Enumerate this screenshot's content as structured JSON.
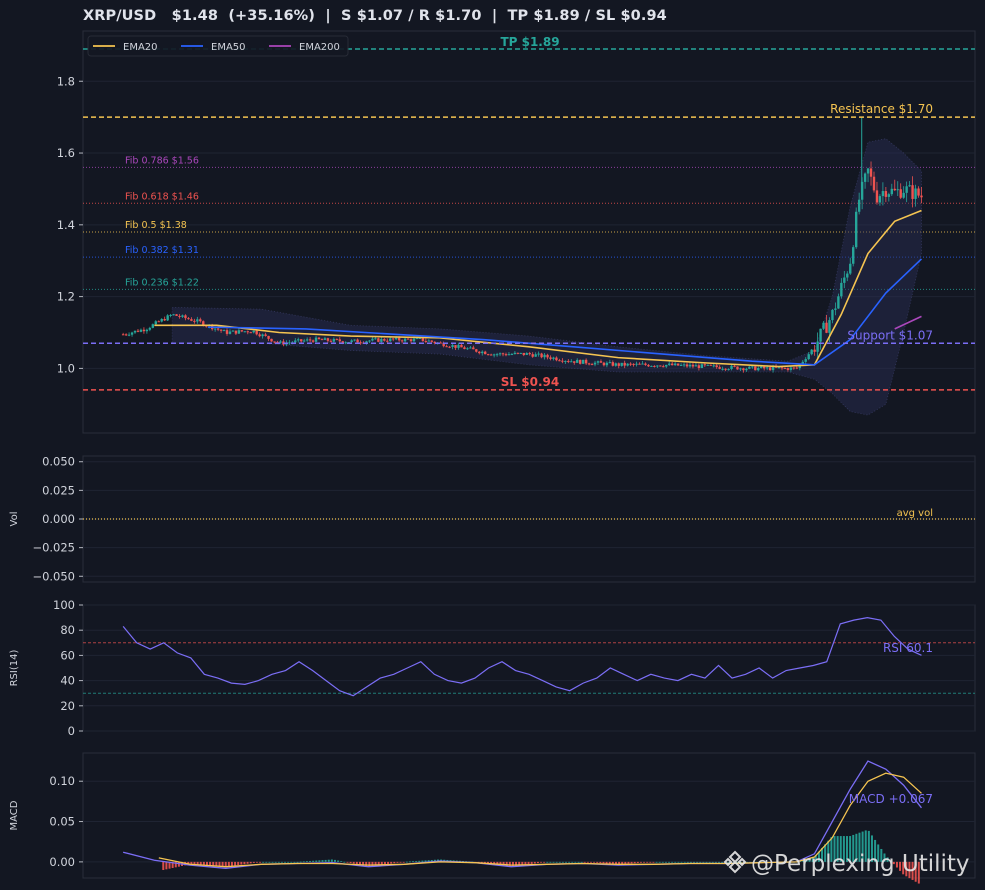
{
  "title": "XRP/USD   $1.48  (+35.16%)  |  S $1.07 / R $1.70  |  TP $1.89 / SL $0.94",
  "watermark": "@Perplexing Utility",
  "colors": {
    "bg": "#131722",
    "grid": "#1f2433",
    "frame": "#2a2e39",
    "up": "#26a69a",
    "down": "#ef5350",
    "ema20": "#f5c451",
    "ema50": "#2962ff",
    "ema200": "#ab47bc",
    "rsi": "#7b6ef6",
    "macd": "#7b6ef6",
    "signal": "#f5c451",
    "tp": "#26a69a",
    "sl": "#ef5350",
    "resistance": "#f5c451",
    "support": "#7b6ef6"
  },
  "chart_data": [
    {
      "type": "line",
      "name": "price",
      "ylim": [
        0.82,
        1.94
      ],
      "yticks": [
        "1.0",
        "1.2",
        "1.4",
        "1.6",
        "1.8"
      ],
      "ytick_values": [
        1.0,
        1.2,
        1.4,
        1.6,
        1.8
      ],
      "legend": {
        "placement": "top-left",
        "entries": [
          "EMA20",
          "EMA50",
          "EMA200"
        ]
      },
      "series": [
        {
          "name": "EMA20",
          "points": [
            [
              0.08,
              1.12
            ],
            [
              0.15,
              1.12
            ],
            [
              0.22,
              1.1
            ],
            [
              0.3,
              1.09
            ],
            [
              0.4,
              1.085
            ],
            [
              0.5,
              1.06
            ],
            [
              0.6,
              1.03
            ],
            [
              0.7,
              1.015
            ],
            [
              0.78,
              1.005
            ],
            [
              0.82,
              1.01
            ],
            [
              0.85,
              1.15
            ],
            [
              0.88,
              1.32
            ],
            [
              0.91,
              1.41
            ],
            [
              0.94,
              1.44
            ]
          ]
        },
        {
          "name": "EMA50",
          "points": [
            [
              0.14,
              1.115
            ],
            [
              0.25,
              1.11
            ],
            [
              0.35,
              1.095
            ],
            [
              0.45,
              1.08
            ],
            [
              0.55,
              1.06
            ],
            [
              0.65,
              1.04
            ],
            [
              0.75,
              1.02
            ],
            [
              0.82,
              1.01
            ],
            [
              0.86,
              1.08
            ],
            [
              0.9,
              1.21
            ],
            [
              0.94,
              1.305
            ]
          ]
        },
        {
          "name": "EMA200",
          "points": [
            [
              0.91,
              1.11
            ],
            [
              0.94,
              1.145
            ]
          ]
        }
      ],
      "levels": [
        {
          "name": "TP",
          "label": "TP $1.89",
          "value": 1.89
        },
        {
          "name": "Resistance",
          "label": "Resistance $1.70",
          "value": 1.7
        },
        {
          "name": "Support",
          "label": "Support $1.07",
          "value": 1.07
        },
        {
          "name": "SL",
          "label": "SL $0.94",
          "value": 0.94
        }
      ],
      "fib": [
        {
          "label": "Fib 0.786 $1.56",
          "value": 1.56,
          "color": "#ab47bc"
        },
        {
          "label": "Fib 0.618 $1.46",
          "value": 1.46,
          "color": "#ef5350"
        },
        {
          "label": "Fib 0.5 $1.38",
          "value": 1.38,
          "color": "#f5c451"
        },
        {
          "label": "Fib 0.382 $1.31",
          "value": 1.31,
          "color": "#2962ff"
        },
        {
          "label": "Fib 0.236 $1.22",
          "value": 1.22,
          "color": "#26a69a"
        }
      ],
      "close_path": [
        [
          0.045,
          1.095
        ],
        [
          0.07,
          1.11
        ],
        [
          0.1,
          1.15
        ],
        [
          0.13,
          1.13
        ],
        [
          0.16,
          1.1
        ],
        [
          0.19,
          1.105
        ],
        [
          0.22,
          1.07
        ],
        [
          0.26,
          1.08
        ],
        [
          0.3,
          1.075
        ],
        [
          0.34,
          1.08
        ],
        [
          0.38,
          1.08
        ],
        [
          0.42,
          1.06
        ],
        [
          0.46,
          1.04
        ],
        [
          0.5,
          1.04
        ],
        [
          0.55,
          1.02
        ],
        [
          0.6,
          1.01
        ],
        [
          0.65,
          1.01
        ],
        [
          0.7,
          1.005
        ],
        [
          0.75,
          1.0
        ],
        [
          0.8,
          1.0
        ],
        [
          0.82,
          1.06
        ],
        [
          0.84,
          1.15
        ],
        [
          0.86,
          1.3
        ],
        [
          0.87,
          1.47
        ],
        [
          0.88,
          1.55
        ],
        [
          0.89,
          1.48
        ],
        [
          0.9,
          1.5
        ],
        [
          0.91,
          1.49
        ],
        [
          0.92,
          1.5
        ],
        [
          0.94,
          1.48
        ]
      ]
    },
    {
      "type": "line",
      "name": "volume",
      "ylabel": "Vol",
      "ylim": [
        -0.055,
        0.055
      ],
      "yticks": [
        "0.050",
        "0.025",
        "0.000",
        "−0.025",
        "−0.050"
      ],
      "ytick_values": [
        0.05,
        0.025,
        0.0,
        -0.025,
        -0.05
      ],
      "avg_label": "avg vol",
      "avg_value": 0.0
    },
    {
      "type": "line",
      "name": "rsi",
      "ylabel": "RSI(14)",
      "ylim": [
        0,
        100
      ],
      "yticks": [
        "0",
        "20",
        "40",
        "60",
        "80",
        "100"
      ],
      "ytick_values": [
        0,
        20,
        40,
        60,
        80,
        100
      ],
      "overbought": 70,
      "oversold": 30,
      "label": "RSI 60.1",
      "values": [
        83,
        70,
        65,
        70,
        62,
        58,
        45,
        42,
        38,
        37,
        40,
        45,
        48,
        55,
        48,
        40,
        32,
        28,
        35,
        42,
        45,
        50,
        55,
        45,
        40,
        38,
        42,
        50,
        55,
        48,
        45,
        40,
        35,
        32,
        38,
        42,
        50,
        45,
        40,
        45,
        42,
        40,
        45,
        42,
        52,
        42,
        45,
        50,
        42,
        48,
        50,
        52,
        55,
        85,
        88,
        90,
        88,
        75,
        65,
        60.1
      ]
    },
    {
      "type": "line",
      "name": "macd",
      "ylabel": "MACD",
      "ylim": [
        -0.02,
        0.135
      ],
      "yticks": [
        "0.00",
        "0.05",
        "0.10"
      ],
      "ytick_values": [
        0.0,
        0.05,
        0.1
      ],
      "label": "MACD +0.067",
      "series": [
        {
          "name": "MACD",
          "points": [
            [
              0.045,
              0.012
            ],
            [
              0.08,
              0.002
            ],
            [
              0.12,
              -0.004
            ],
            [
              0.16,
              -0.008
            ],
            [
              0.2,
              -0.003
            ],
            [
              0.24,
              -0.002
            ],
            [
              0.28,
              -0.001
            ],
            [
              0.32,
              -0.006
            ],
            [
              0.36,
              -0.003
            ],
            [
              0.4,
              0.001
            ],
            [
              0.44,
              -0.001
            ],
            [
              0.48,
              -0.006
            ],
            [
              0.52,
              -0.003
            ],
            [
              0.56,
              -0.002
            ],
            [
              0.6,
              -0.004
            ],
            [
              0.64,
              -0.003
            ],
            [
              0.68,
              -0.002
            ],
            [
              0.72,
              -0.002
            ],
            [
              0.76,
              -0.001
            ],
            [
              0.8,
              0.0
            ],
            [
              0.82,
              0.01
            ],
            [
              0.84,
              0.05
            ],
            [
              0.86,
              0.09
            ],
            [
              0.88,
              0.125
            ],
            [
              0.9,
              0.115
            ],
            [
              0.92,
              0.095
            ],
            [
              0.94,
              0.067
            ]
          ]
        },
        {
          "name": "Signal",
          "points": [
            [
              0.085,
              0.005
            ],
            [
              0.12,
              -0.003
            ],
            [
              0.16,
              -0.006
            ],
            [
              0.2,
              -0.003
            ],
            [
              0.24,
              -0.002
            ],
            [
              0.28,
              -0.002
            ],
            [
              0.32,
              -0.004
            ],
            [
              0.36,
              -0.003
            ],
            [
              0.4,
              0.0
            ],
            [
              0.44,
              -0.001
            ],
            [
              0.48,
              -0.004
            ],
            [
              0.52,
              -0.003
            ],
            [
              0.56,
              -0.002
            ],
            [
              0.6,
              -0.003
            ],
            [
              0.64,
              -0.003
            ],
            [
              0.68,
              -0.002
            ],
            [
              0.72,
              -0.002
            ],
            [
              0.76,
              -0.001
            ],
            [
              0.8,
              0.0
            ],
            [
              0.82,
              0.006
            ],
            [
              0.84,
              0.03
            ],
            [
              0.86,
              0.07
            ],
            [
              0.88,
              0.1
            ],
            [
              0.9,
              0.11
            ],
            [
              0.92,
              0.105
            ],
            [
              0.94,
              0.085
            ]
          ]
        }
      ]
    }
  ]
}
